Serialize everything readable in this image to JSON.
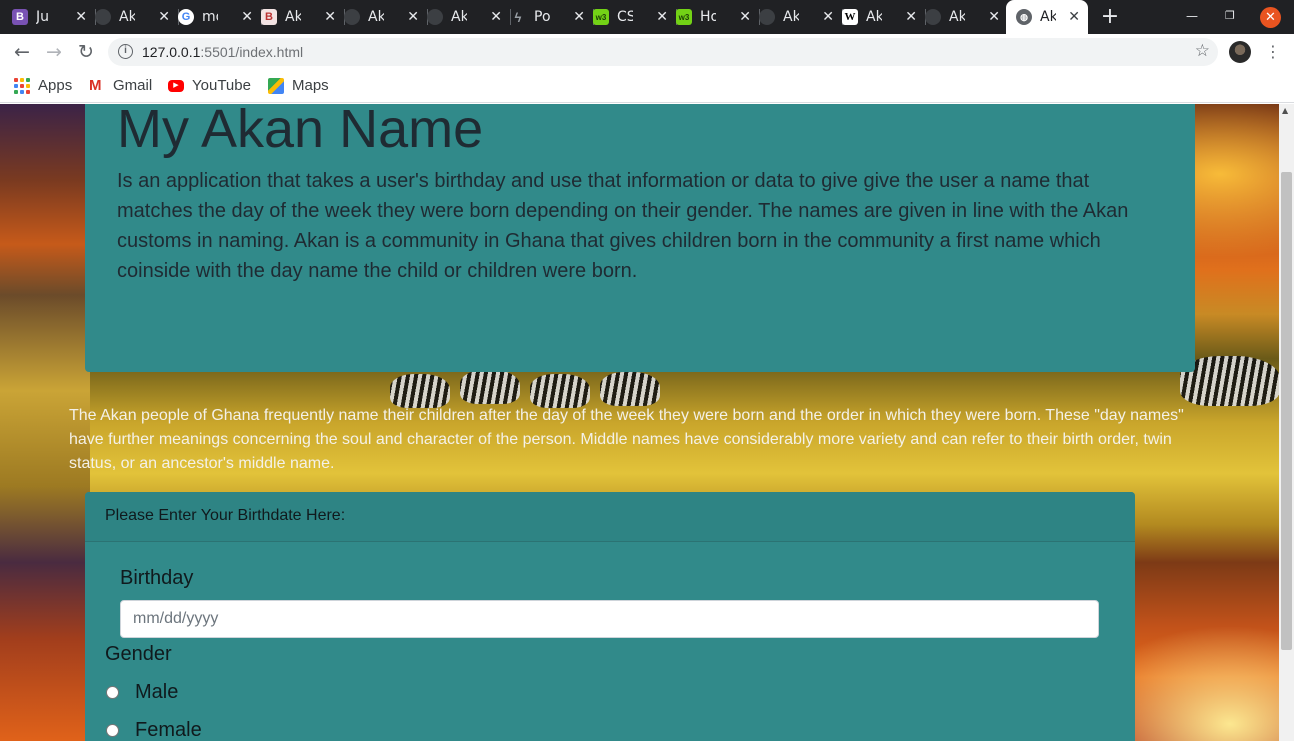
{
  "browser": {
    "tabs": [
      {
        "title": "Ju",
        "favicon": "bootstrap-icon",
        "color": "#7952b3",
        "glyph": "B"
      },
      {
        "title": "Ak",
        "favicon": "github-icon",
        "color": "#3c3f43",
        "glyph": ""
      },
      {
        "title": "mo",
        "favicon": "google-icon",
        "color": "#ffffff",
        "glyph": "G"
      },
      {
        "title": "Ak",
        "favicon": "behance-icon",
        "color": "#e9d5d5",
        "glyph": "B"
      },
      {
        "title": "Ak",
        "favicon": "github-icon",
        "color": "#3c3f43",
        "glyph": ""
      },
      {
        "title": "Ak",
        "favicon": "github-icon",
        "color": "#3c3f43",
        "glyph": ""
      },
      {
        "title": "Po",
        "favicon": "postman-icon",
        "color": "#3c3f43",
        "glyph": "⚡"
      },
      {
        "title": "CS",
        "favicon": "w3schools-icon",
        "color": "#73d216",
        "glyph": "w3"
      },
      {
        "title": "Ho",
        "favicon": "w3schools-icon",
        "color": "#73d216",
        "glyph": "w3"
      },
      {
        "title": "Ak",
        "favicon": "github-icon",
        "color": "#3c3f43",
        "glyph": ""
      },
      {
        "title": "Ak",
        "favicon": "wikipedia-icon",
        "color": "#ffffff",
        "glyph": "W"
      },
      {
        "title": "Ak",
        "favicon": "github-icon",
        "color": "#3c3f43",
        "glyph": ""
      },
      {
        "title": "Ak",
        "favicon": "globe-icon",
        "color": "#5f6368",
        "glyph": "🌐",
        "active": true
      }
    ],
    "url_host": "127.0.0.1",
    "url_rest": ":5501/index.html",
    "bookmarks": [
      {
        "label": "Apps",
        "icon": "apps-grid-icon"
      },
      {
        "label": "Gmail",
        "icon": "gmail-icon"
      },
      {
        "label": "YouTube",
        "icon": "youtube-icon"
      },
      {
        "label": "Maps",
        "icon": "maps-icon"
      }
    ]
  },
  "page": {
    "title": "My Akan Name",
    "description": "Is an application that takes a user's birthday and use that information or data to give give the user a name that matches the day of the week they were born depending on their gender. The names are given in line with the Akan customs in naming. Akan is a community in Ghana that gives children born in the community a first name which coinside with the day name the child or children were born.",
    "intro": "The Akan people of Ghana frequently name their children after the day of the week they were born and the order in which they were born. These \"day names\" have further meanings concerning the soul and character of the person. Middle names have considerably more variety and can refer to their birth order, twin status, or an ancestor's middle name.",
    "form": {
      "header": "Please Enter Your Birthdate Here:",
      "birthday_label": "Birthday",
      "birthday_placeholder": "mm/dd/yyyy",
      "gender_label": "Gender",
      "options": [
        "Male",
        "Female"
      ]
    },
    "colors": {
      "panel": "#318a8a",
      "text_dark": "#1f2b33"
    }
  }
}
